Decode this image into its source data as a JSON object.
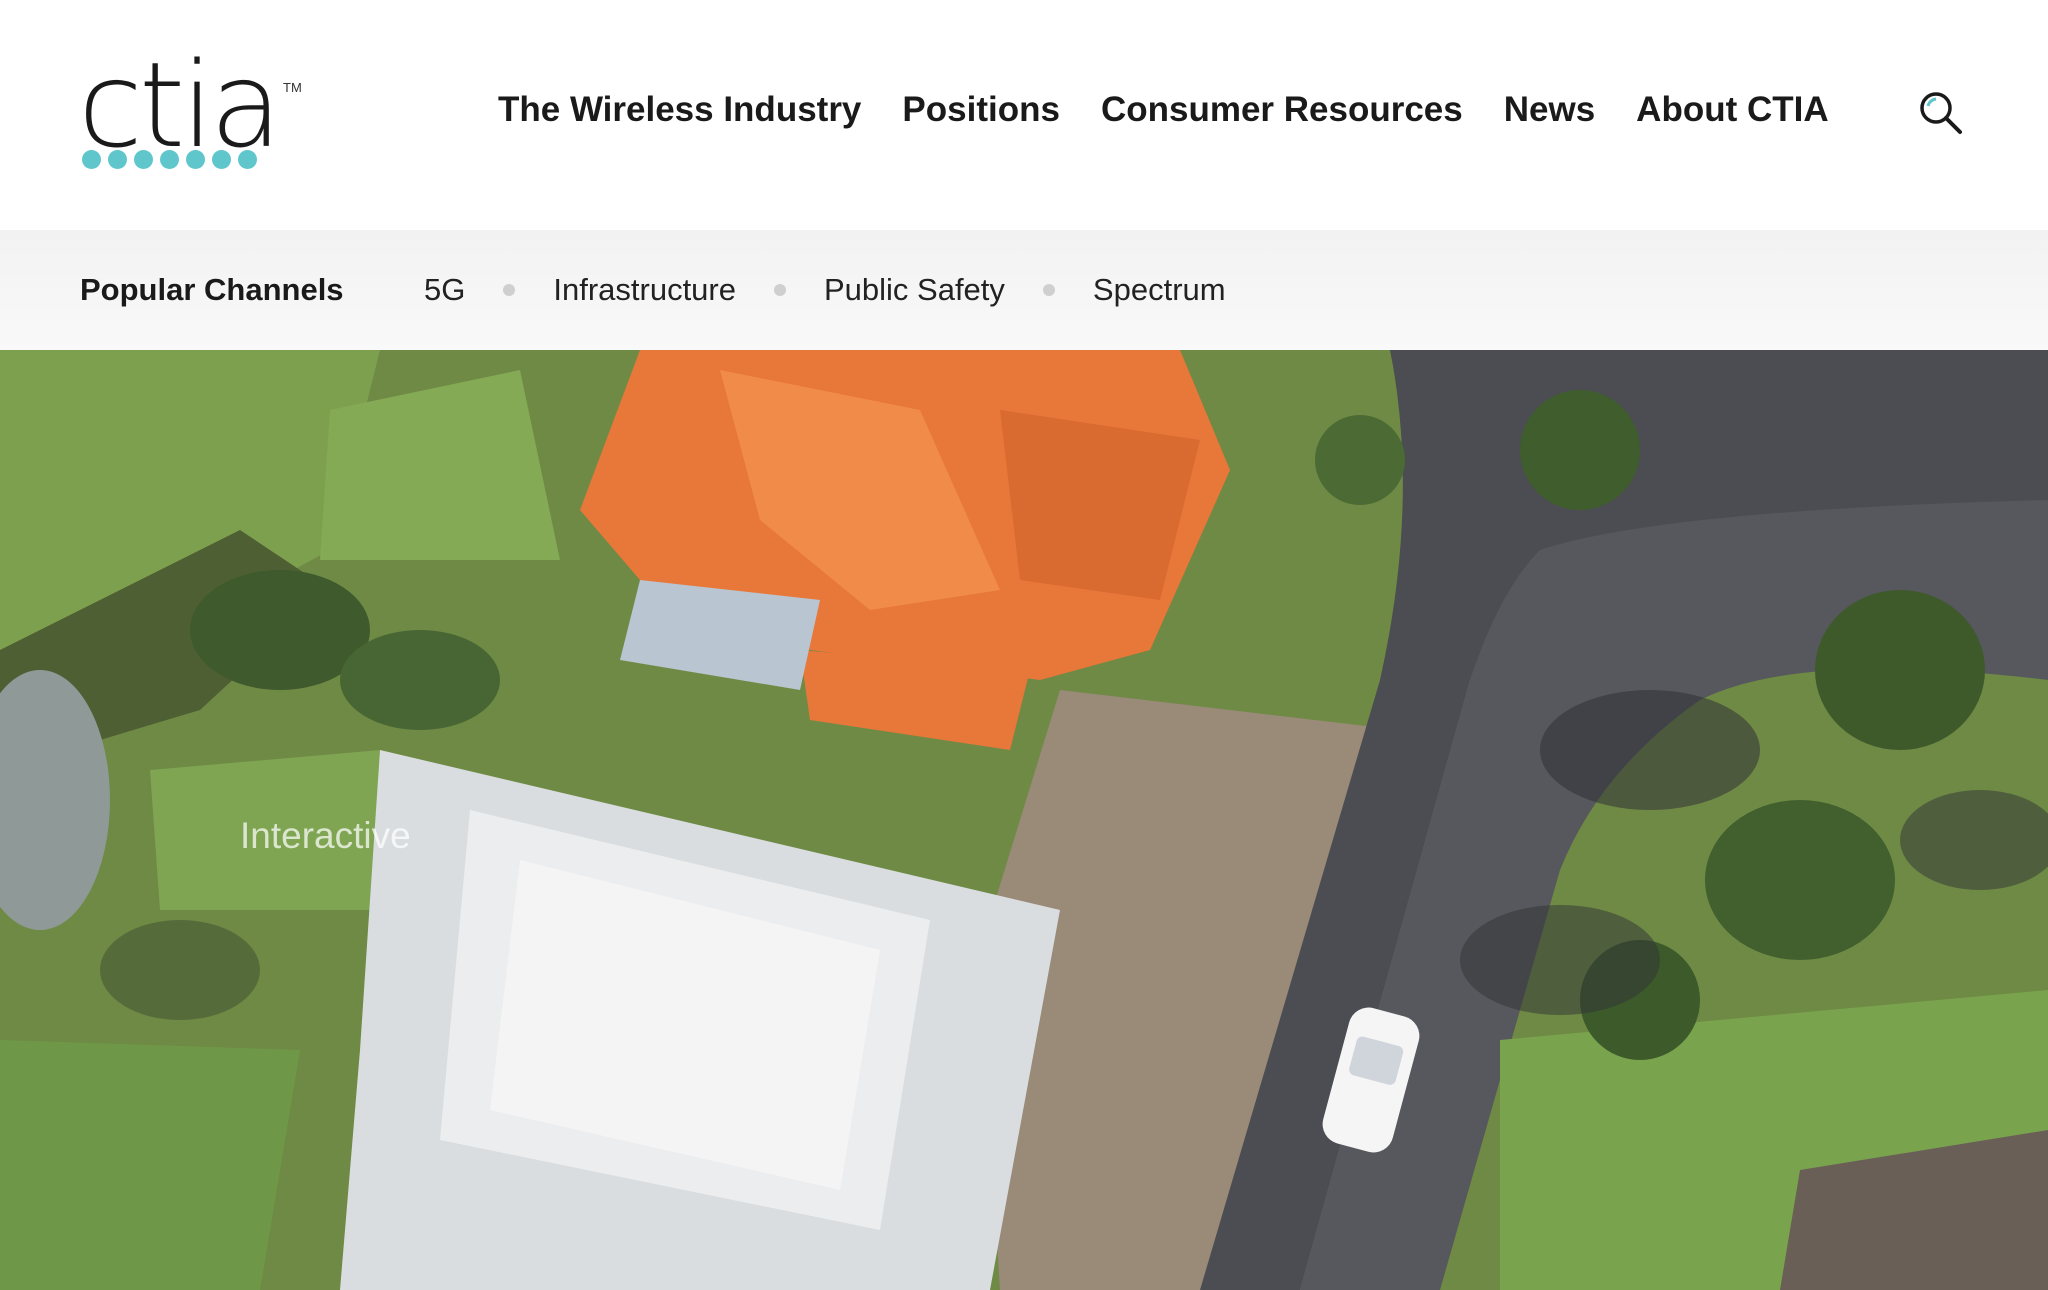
{
  "header": {
    "logo_text": "ctia",
    "logo_tm": "TM",
    "nav": [
      {
        "label": "The Wireless Industry"
      },
      {
        "label": "Positions"
      },
      {
        "label": "Consumer Resources"
      },
      {
        "label": "News"
      },
      {
        "label": "About CTIA"
      }
    ],
    "search_icon": "search-icon"
  },
  "channels": {
    "label": "Popular Channels",
    "items": [
      {
        "label": "5G"
      },
      {
        "label": "Infrastructure"
      },
      {
        "label": "Public Safety"
      },
      {
        "label": "Spectrum"
      }
    ]
  },
  "hero": {
    "caption": "Interactive"
  },
  "colors": {
    "brand_dots": "#5fc7cc",
    "roof_orange": "#e8773a",
    "text": "#1a1a1a"
  }
}
